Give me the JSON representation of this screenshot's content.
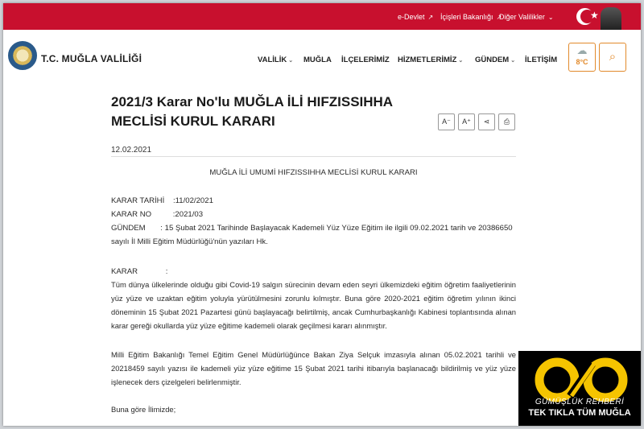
{
  "topbar": {
    "links": [
      {
        "label": "e-Devlet",
        "icon": "external-link-icon"
      },
      {
        "label": "İçişleri Bakanlığı",
        "icon": "external-link-icon"
      },
      {
        "label": "Diğer Valilikler",
        "icon": "chevron-down-icon"
      }
    ]
  },
  "header": {
    "brand": "T.C. MUĞLA VALİLİĞİ",
    "nav": [
      {
        "label": "VALİLİK",
        "dropdown": true
      },
      {
        "label": "MUĞLA",
        "dropdown": false
      },
      {
        "label": "İLÇELERİMİZ",
        "dropdown": false
      },
      {
        "label": "HİZMETLERİMİZ",
        "dropdown": true
      },
      {
        "label": "GÜNDEM",
        "dropdown": true
      },
      {
        "label": "İLETİŞİM",
        "dropdown": false
      }
    ],
    "weather": {
      "temp": "8°C",
      "icon": "cloud-icon"
    },
    "search_icon": "search-icon"
  },
  "article": {
    "title_line1": "2021/3 Karar No'lu MUĞLA İLİ HIFZISSIHHA",
    "title_line2": "MECLİSİ KURUL KARARI",
    "tools": {
      "decrease": "A⁻",
      "increase": "A⁺",
      "share_icon": "share-icon",
      "print_icon": "print-icon"
    },
    "date": "12.02.2021",
    "heading": "MUĞLA İLİ UMUMİ HIFZISSIHHA MECLİSİ KURUL KARARI",
    "karar_tarihi": "KARAR TARİHİ    :11/02/2021",
    "karar_no": "KARAR NO          :2021/03",
    "gundem_line1": "GÜNDEM       : 15 Şubat 2021 Tarihinde Başlayacak Kademeli Yüz Yüze Eğitim ile ilgili 09.02.2021 tarih ve 20386650",
    "gundem_line2": "sayılı İl Milli Eğitim Müdürlüğü'nün yazıları Hk.",
    "karar_label": "KARAR             :",
    "para1": "Tüm dünya ülkelerinde olduğu gibi Covid-19 salgın sürecinin devam eden seyri ülkemizdeki eğitim öğretim faaliyetlerinin yüz yüze ve uzaktan eğitim yoluyla yürütülmesini zorunlu kılmıştır. Buna göre 2020-2021 eğitim öğretim yılının ikinci döneminin 15 Şubat 2021 Pazartesi günü başlayacağı belirtilmiş, ancak Cumhurbaşkanlığı Kabinesi toplantısında alınan karar gereği okullarda yüz yüze eğitime kademeli olarak geçilmesi kararı alınmıştır.",
    "para2": "Milli Eğitim Bakanlığı Temel Eğitim Genel Müdürlüğünce Bakan Ziya Selçuk imzasıyla alınan 05.02.2021 tarihli ve 20218459 sayılı  yazısı ile kademeli yüz yüze eğitime 15 Şubat 2021 tarihi itibarıyla başlanacağı bildirilmiş ve yüz yüze işlenecek ders çizelgeleri belirlenmiştir.",
    "para3": "Buna göre İlimizde;"
  },
  "watermark": {
    "name": "GÜMÜŞLÜK REHBERİ",
    "tagline": "TEK TIKLA TÜM MUĞLA",
    "accent": "#f5c400"
  }
}
